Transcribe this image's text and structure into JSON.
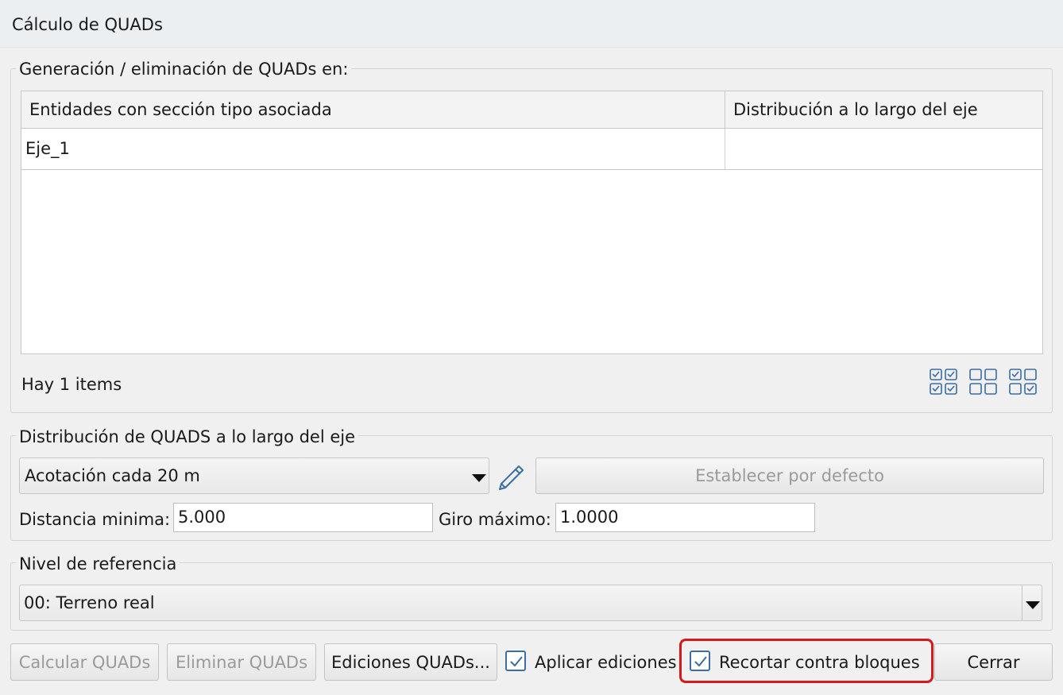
{
  "window": {
    "title": "Cálculo de QUADs"
  },
  "group_entities": {
    "legend": "Generación / eliminación de QUADs en:",
    "columns": [
      "Entidades con sección tipo asociada",
      "Distribución a lo largo del eje"
    ],
    "rows": [
      [
        "Eje_1",
        ""
      ]
    ],
    "status": "Hay 1 items",
    "icons": [
      "select-all-icon",
      "select-none-icon",
      "invert-selection-icon"
    ]
  },
  "group_distribution": {
    "legend": "Distribución de QUADS a lo largo del eje",
    "mode_selected": "Acotación cada 20 m",
    "set_default_label": "Establecer por defecto",
    "min_distance_label": "Distancia minima:",
    "min_distance_value": "5.000",
    "max_turn_label": "Giro máximo:",
    "max_turn_value": "1.0000"
  },
  "group_reference": {
    "legend": "Nivel de referencia",
    "selected": "00: Terreno real"
  },
  "footer": {
    "calc_label": "Calcular QUADs",
    "delete_label": "Eliminar QUADs",
    "edits_label": "Ediciones QUADs...",
    "apply_edits_label": "Aplicar ediciones",
    "apply_edits_checked": true,
    "clip_blocks_label": "Recortar contra bloques",
    "clip_blocks_checked": true,
    "close_label": "Cerrar"
  },
  "colors": {
    "accent": "#3a6ea5",
    "highlight": "#d8171b",
    "disabled_text": "#9a9a9a"
  }
}
